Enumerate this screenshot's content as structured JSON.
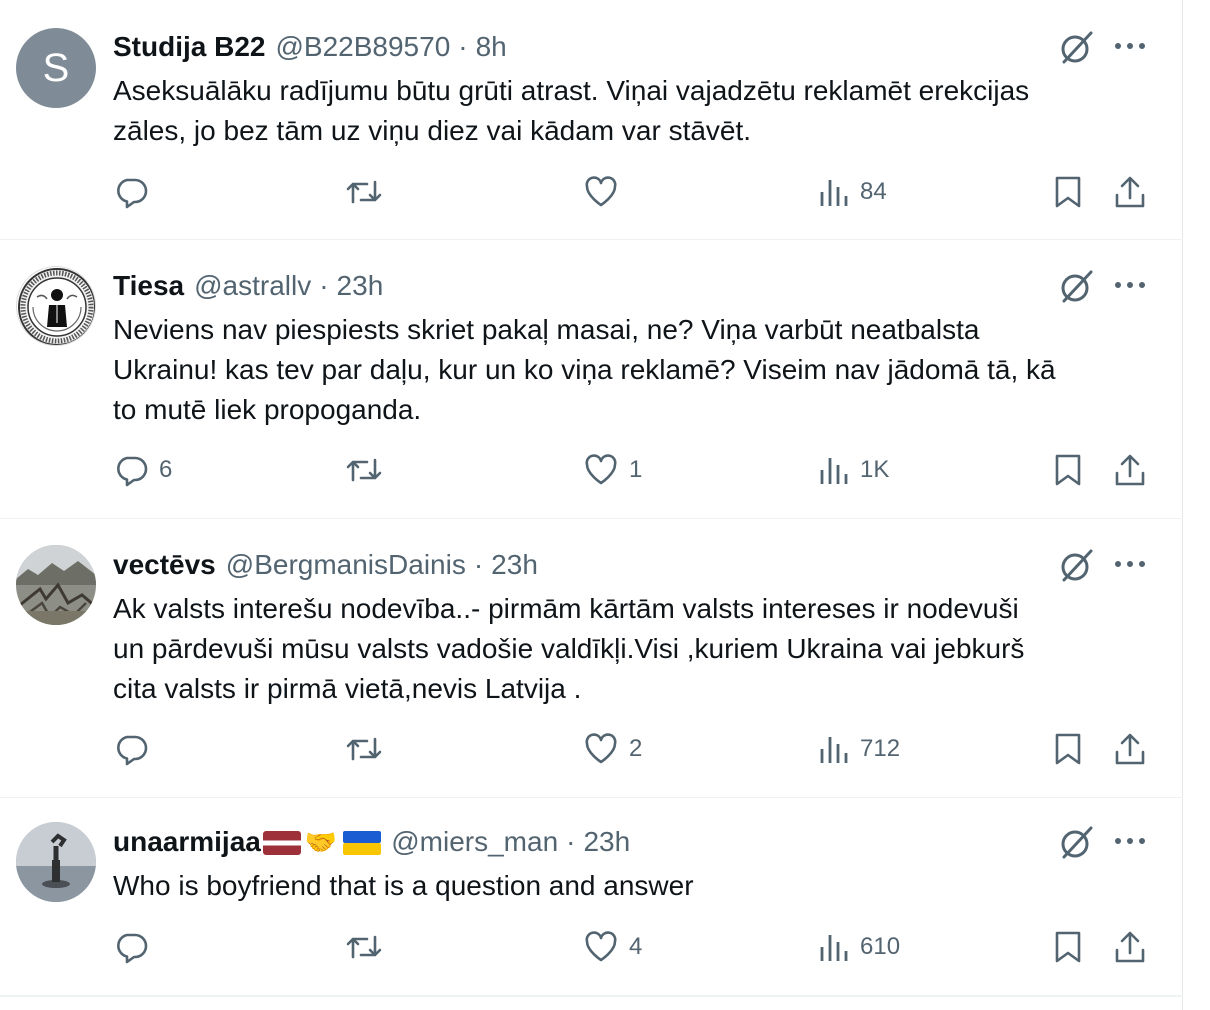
{
  "tweets": [
    {
      "name": "Studija B22",
      "handle": "@B22B89570",
      "time": "8h",
      "avatar_letter": "S",
      "lines": [
        "Aseksuālāku radījumu būtu grūti atrast. Viņai vajadzētu reklamēt erekcijas",
        "zāles, jo bez tām uz viņu diez vai kādam var stāvēt."
      ],
      "replies": "",
      "retweets": "",
      "likes": "",
      "views": "84"
    },
    {
      "name": "Tiesa",
      "handle": "@astrallv",
      "time": "23h",
      "lines": [
        "Neviens nav piespiests skriet pakaļ masai, ne? Viņa varbūt neatbalsta",
        "Ukrainu! kas tev par daļu, kur un ko viņa reklamē? Viseim nav jādomā tā, kā",
        "to mutē liek propoganda."
      ],
      "replies": "6",
      "retweets": "",
      "likes": "1",
      "views": "1K"
    },
    {
      "name": "vectēvs",
      "handle": "@BergmanisDainis",
      "time": "23h",
      "lines": [
        "Ak valsts interešu nodevība..- pirmām kārtām valsts intereses ir nodevuši",
        "un pārdevuši mūsu valsts vadošie valdīkļi.Visi ,kuriem Ukraina vai jebkurš",
        "cita valsts ir pirmā vietā,nevis Latvija ."
      ],
      "replies": "",
      "retweets": "",
      "likes": "2",
      "views": "712"
    },
    {
      "name": "unaarmijaa",
      "handle": "@miers_man",
      "time": "23h",
      "lines": [
        "Who is boyfriend that is a question and answer"
      ],
      "replies": "",
      "retweets": "",
      "likes": "4",
      "views": "610"
    }
  ],
  "separator": "·",
  "colors": {
    "secondary_text": "#536471",
    "primary_text": "#0f1419",
    "divider": "#eff3f4"
  },
  "icons": [
    "reply-icon",
    "retweet-icon",
    "like-icon",
    "views-icon",
    "bookmark-icon",
    "share-icon",
    "grok-icon",
    "more-icon"
  ]
}
